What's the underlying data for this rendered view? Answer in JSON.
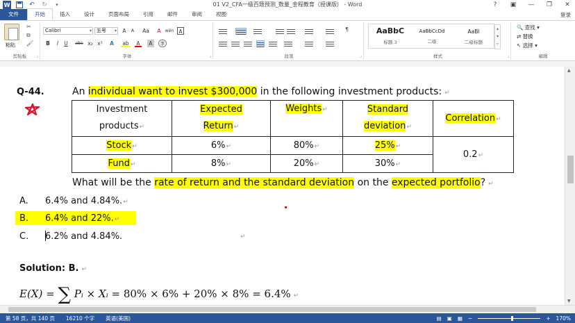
{
  "window": {
    "title": "01 V2_CFA一级百题预测_数量_金程教育（授课版） - Word",
    "controls": {
      "help": "?",
      "ribbon_display": "▣",
      "minimize": "—",
      "restore": "❐",
      "close": "✕"
    }
  },
  "quick_access": {
    "app_icon": "W",
    "save_icon": "save-icon",
    "undo_icon": "undo-icon",
    "redo_icon": "redo-icon"
  },
  "ribbon_tabs": [
    "文件",
    "开始",
    "插入",
    "设计",
    "页面布局",
    "引用",
    "邮件",
    "审阅",
    "视图"
  ],
  "account": {
    "login_label": "登录"
  },
  "clipboard": {
    "paste_label": "粘贴",
    "group_label": "剪贴板"
  },
  "font": {
    "font_name": "Calibri",
    "font_size": "五号",
    "grow": "A",
    "shrink": "A",
    "change_case": "Aa",
    "clear_format": "A",
    "phonetic": "wén",
    "enclose": "A",
    "bold": "B",
    "italic": "I",
    "underline": "U",
    "strike": "abc",
    "subscript": "x₂",
    "superscript": "x²",
    "text_effects": "A",
    "highlight": "ab",
    "font_color": "A",
    "char_shading": "A",
    "char_border": "字",
    "group_label": "字体"
  },
  "paragraph": {
    "group_label": "段落"
  },
  "styles": {
    "items": [
      {
        "sample": "AaBbC",
        "name": "标题 3"
      },
      {
        "sample": "AaBbCcDd",
        "name": "二级"
      },
      {
        "sample": "AaBl",
        "name": "二级标题"
      }
    ],
    "group_label": "样式"
  },
  "editing": {
    "find": "查找",
    "replace": "替换",
    "select": "选择",
    "group_label": "编辑"
  },
  "document": {
    "question_label": "Q-44.",
    "question_intro_before": "An ",
    "question_intro_hl": "individual want to invest $300,000",
    "question_intro_after": " in the following investment products:",
    "table": {
      "headers": {
        "col1_line1": "Investment",
        "col1_line2": "products",
        "col2_line1": "Expected",
        "col2_line2": "Return",
        "col3": "Weights",
        "col4_line1": "Standard",
        "col4_line2": "deviation",
        "col5": "Correlation"
      },
      "rows": [
        {
          "product": "Stock",
          "return": "6%",
          "weight": "80%",
          "std": "25%"
        },
        {
          "product": "Fund",
          "return": "8%",
          "weight": "20%",
          "std": "30%"
        }
      ],
      "correlation_value": "0.2"
    },
    "question_line2": {
      "part1": "What will be the ",
      "hl1": "rate of return and the standard deviation",
      "part2": " on the ",
      "hl2": "expected portfolio",
      "part3": "?"
    },
    "options": [
      {
        "letter": "A.",
        "text": "6.4% and 4.84%."
      },
      {
        "letter": "B.",
        "text": "6.4% and 22%."
      },
      {
        "letter": "C.",
        "text": "6.2% and 4.84%."
      }
    ],
    "solution_label": "Solution: B.",
    "formula": {
      "lhs": "E(X) =",
      "sigma": "∑",
      "term": "Pᵢ × Xᵢ",
      "rhs": "= 80% × 6% + 20% × 8% = 6.4%"
    }
  },
  "status_bar": {
    "page": "第 58 页，共 140 页",
    "words": "16210 个字",
    "language": "英语(美国)",
    "zoom_minus": "−",
    "zoom_plus": "+",
    "zoom": "170%",
    "zoom_fraction": 0.55
  },
  "colors": {
    "word_blue": "#2b579a",
    "highlight_yellow": "#ffff00"
  }
}
